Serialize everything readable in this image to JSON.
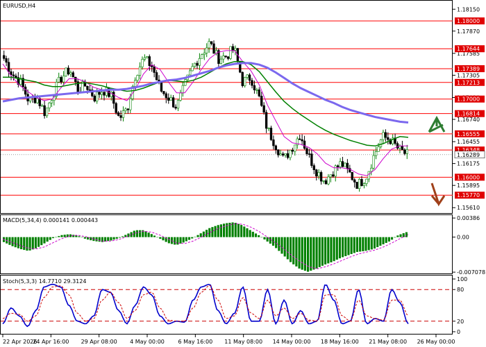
{
  "window_title": "EURUSD,H4",
  "colors": {
    "bull": "#008000",
    "bear": "#000000",
    "level": "#ff0000",
    "level_tag": "#e00000",
    "ma_fast": "#cc00cc",
    "ma_mid": "#008000",
    "ma_slow": "#7b68ee",
    "macd_hist": "#008000",
    "macd_signal": "#cc00cc",
    "stoch_main": "#0000cc",
    "stoch_signal": "#cc0000",
    "up_arrow": "#2e7d32",
    "down_arrow": "#a0401a"
  },
  "icons": {
    "up": "up-arrow-icon",
    "down": "down-arrow-icon"
  },
  "chart_data": [
    {
      "type": "candlestick",
      "title": "EURUSD,H4",
      "ylim": [
        1.5595,
        1.1825
      ],
      "y_ticks": [
        "1.18150",
        "1.17870",
        "1.17585",
        "1.17305",
        "1.17020",
        "1.16740",
        "1.16455",
        "1.16175",
        "1.15895",
        "1.15610"
      ],
      "resistance_levels": [
        "1.18000",
        "1.17644",
        "1.17389",
        "1.17213",
        "1.17000",
        "1.16814",
        "1.16555",
        "1.16348",
        "1.16000",
        "1.15770"
      ],
      "current_price": "1.16289",
      "x_labels": [
        "22 Apr 2026",
        "24 Apr 16:00",
        "29 Apr 08:00",
        "4 May 00:00",
        "6 May 16:00",
        "11 May 08:00",
        "14 May 00:00",
        "18 May 16:00",
        "21 May 08:00",
        "26 May 00:00"
      ],
      "close_anchors": [
        1.1752,
        1.1732,
        1.1722,
        1.1698,
        1.1702,
        1.1682,
        1.1708,
        1.1728,
        1.1738,
        1.1712,
        1.1718,
        1.1702,
        1.1712,
        1.1705,
        1.1675,
        1.1688,
        1.1732,
        1.1752,
        1.1742,
        1.1712,
        1.1702,
        1.169,
        1.1718,
        1.1742,
        1.1758,
        1.1772,
        1.1752,
        1.1755,
        1.1765,
        1.1722,
        1.1728,
        1.1702,
        1.1662,
        1.1642,
        1.1622,
        1.1638,
        1.1655,
        1.1628,
        1.1608,
        1.1595,
        1.1608,
        1.1618,
        1.1605,
        1.159,
        1.16,
        1.1628,
        1.1652,
        1.1648,
        1.1635,
        1.1629
      ],
      "series": [
        {
          "name": "",
          "kind": "ma_fast",
          "values": [
            1.1745,
            1.173,
            1.1718,
            1.171,
            1.1702,
            1.1698,
            1.17,
            1.1714,
            1.1726,
            1.1726,
            1.1722,
            1.1715,
            1.1712,
            1.1708,
            1.1702,
            1.1698,
            1.1712,
            1.1732,
            1.1744,
            1.1738,
            1.1722,
            1.1708,
            1.1708,
            1.1722,
            1.1738,
            1.1752,
            1.176,
            1.1762,
            1.1762,
            1.1748,
            1.1736,
            1.1718,
            1.1692,
            1.1672,
            1.1652,
            1.1644,
            1.1642,
            1.1638,
            1.163,
            1.1618,
            1.1612,
            1.1612,
            1.161,
            1.1604,
            1.1602,
            1.161,
            1.1624,
            1.1636,
            1.164,
            1.164
          ]
        },
        {
          "name": "",
          "kind": "ma_mid",
          "values": [
            1.1728,
            1.1728,
            1.1726,
            1.1724,
            1.1722,
            1.1718,
            1.1716,
            1.1716,
            1.1718,
            1.172,
            1.1721,
            1.1719,
            1.1717,
            1.1714,
            1.1712,
            1.171,
            1.1711,
            1.1714,
            1.1718,
            1.1722,
            1.1724,
            1.1723,
            1.1722,
            1.1724,
            1.1728,
            1.1734,
            1.174,
            1.1745,
            1.1748,
            1.1748,
            1.1744,
            1.1735,
            1.1722,
            1.1709,
            1.1697,
            1.1688,
            1.168,
            1.1673,
            1.1666,
            1.166,
            1.1655,
            1.1651,
            1.1647,
            1.1644,
            1.1641,
            1.164,
            1.1643,
            1.1648,
            1.1652,
            1.1651
          ]
        },
        {
          "name": "",
          "kind": "ma_slow",
          "values": [
            1.1697,
            1.1699,
            1.1701,
            1.1702,
            1.1703,
            1.1704,
            1.1705,
            1.1706,
            1.1707,
            1.1708,
            1.1709,
            1.171,
            1.1711,
            1.1712,
            1.1712,
            1.1713,
            1.1715,
            1.1717,
            1.172,
            1.1722,
            1.1724,
            1.1725,
            1.1727,
            1.173,
            1.1733,
            1.1736,
            1.174,
            1.1743,
            1.1745,
            1.1746,
            1.1746,
            1.1744,
            1.174,
            1.1734,
            1.1727,
            1.172,
            1.1714,
            1.1709,
            1.1704,
            1.1699,
            1.1695,
            1.169,
            1.1686,
            1.1683,
            1.168,
            1.1677,
            1.1675,
            1.1673,
            1.1671,
            1.167
          ]
        }
      ]
    },
    {
      "type": "bar",
      "title": "MACD(5,34,4) 0.000141 0.000443",
      "ylim": [
        -0.0072,
        0.0043
      ],
      "y_ticks": [
        "0.00386",
        "0.00",
        "-0.007078"
      ],
      "series": [
        {
          "name": "MACD",
          "kind": "hist",
          "values": [
            -0.001,
            -0.0018,
            -0.0024,
            -0.0028,
            -0.0022,
            -0.0012,
            -0.0002,
            0.0004,
            0.0006,
            0.0003,
            -0.0004,
            -0.0008,
            -0.001,
            -0.0007,
            -0.0002,
            0.0006,
            0.0014,
            0.0014,
            0.0006,
            -0.0003,
            -0.0012,
            -0.0016,
            -0.001,
            -0.0002,
            0.0008,
            0.0018,
            0.0024,
            0.0028,
            0.003,
            0.0024,
            0.0014,
            0.0004,
            -0.0008,
            -0.002,
            -0.0036,
            -0.0052,
            -0.0064,
            -0.007,
            -0.0064,
            -0.0056,
            -0.005,
            -0.0042,
            -0.0036,
            -0.003,
            -0.0028,
            -0.0024,
            -0.0016,
            -0.0008,
            0.0004,
            0.001
          ]
        },
        {
          "name": "Signal",
          "kind": "signal",
          "values": [
            -0.0004,
            -0.001,
            -0.0016,
            -0.0022,
            -0.0024,
            -0.002,
            -0.0012,
            -0.0004,
            0.0002,
            0.0004,
            0.0001,
            -0.0004,
            -0.0008,
            -0.0008,
            -0.0005,
            0.0001,
            0.0008,
            0.0012,
            0.001,
            0.0004,
            -0.0004,
            -0.0012,
            -0.0013,
            -0.0008,
            0.0,
            0.0009,
            0.0017,
            0.0023,
            0.0027,
            0.0026,
            0.002,
            0.0011,
            0.0,
            -0.0012,
            -0.0024,
            -0.0038,
            -0.005,
            -0.006,
            -0.0064,
            -0.006,
            -0.0054,
            -0.0047,
            -0.004,
            -0.0034,
            -0.003,
            -0.0026,
            -0.002,
            -0.0012,
            -0.0003,
            0.0005
          ]
        }
      ]
    },
    {
      "type": "line",
      "title": "Stoch(5,3,3) 14.7710 29.3124",
      "ylim": [
        0,
        100
      ],
      "y_ticks": [
        "100",
        "80",
        "20",
        "0"
      ],
      "levels": [
        80,
        20
      ],
      "series": [
        {
          "name": "Main",
          "kind": "main",
          "values": [
            15,
            45,
            30,
            10,
            40,
            85,
            90,
            85,
            50,
            20,
            15,
            30,
            80,
            75,
            40,
            15,
            50,
            85,
            70,
            30,
            15,
            20,
            18,
            60,
            85,
            90,
            40,
            15,
            35,
            85,
            20,
            20,
            80,
            15,
            60,
            15,
            40,
            15,
            20,
            90,
            60,
            15,
            20,
            80,
            15,
            25,
            20,
            80,
            55,
            15
          ]
        },
        {
          "name": "Signal",
          "kind": "signal",
          "values": [
            25,
            35,
            33,
            20,
            30,
            65,
            85,
            87,
            70,
            35,
            20,
            25,
            60,
            75,
            55,
            25,
            40,
            70,
            75,
            45,
            22,
            20,
            20,
            45,
            75,
            88,
            60,
            25,
            30,
            65,
            35,
            25,
            60,
            30,
            45,
            25,
            35,
            22,
            20,
            70,
            70,
            30,
            20,
            60,
            30,
            25,
            22,
            60,
            60,
            30
          ]
        }
      ]
    }
  ]
}
